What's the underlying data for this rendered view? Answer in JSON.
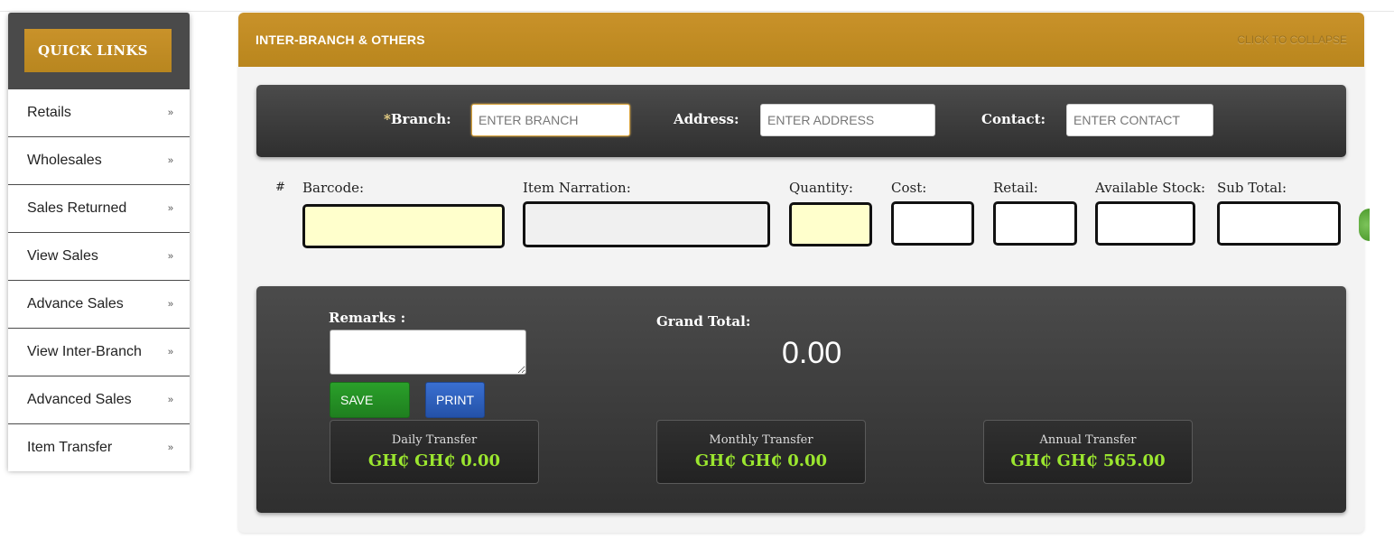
{
  "sidebar": {
    "title": "QUICK LINKS",
    "chevron": "»",
    "items": [
      {
        "label": "Retails"
      },
      {
        "label": "Wholesales"
      },
      {
        "label": "Sales Returned"
      },
      {
        "label": "View Sales"
      },
      {
        "label": "Advance Sales"
      },
      {
        "label": "View Inter-Branch"
      },
      {
        "label": "Advanced Sales"
      },
      {
        "label": "Item Transfer"
      }
    ]
  },
  "panel": {
    "title": "INTER-BRANCH & OTHERS",
    "collapse": "CLICK TO COLLAPSE"
  },
  "branch": {
    "required_mark": "*",
    "branch_label": "Branch:",
    "branch_placeholder": "ENTER BRANCH",
    "address_label": "Address:",
    "address_placeholder": "ENTER ADDRESS",
    "contact_label": "Contact:",
    "contact_placeholder": "ENTER CONTACT"
  },
  "items_row": {
    "hash": "#",
    "barcode": "Barcode:",
    "narration": "Item Narration:",
    "quantity": "Quantity:",
    "cost": "Cost:",
    "retail": "Retail:",
    "stock": "Available Stock:",
    "subtotal": "Sub Total:"
  },
  "totals": {
    "remarks_label": "Remarks :",
    "grand_total_label": "Grand Total:",
    "grand_total_value": "0.00",
    "save": "SAVE",
    "print": "PRINT",
    "stats": [
      {
        "label": "Daily Transfer",
        "value": "GH₵ GH₵ 0.00"
      },
      {
        "label": "Monthly Transfer",
        "value": "GH₵ GH₵ 0.00"
      },
      {
        "label": "Annual Transfer",
        "value": "GH₵ GH₵ 565.00"
      }
    ]
  },
  "colors": {
    "accent_gold": "#c9922a",
    "dark_panel": "#3d3d3d",
    "stat_green": "#9be62f",
    "save_green": "#2aa02a",
    "print_blue": "#3a6fd0",
    "input_yellow": "#ffffcc"
  }
}
